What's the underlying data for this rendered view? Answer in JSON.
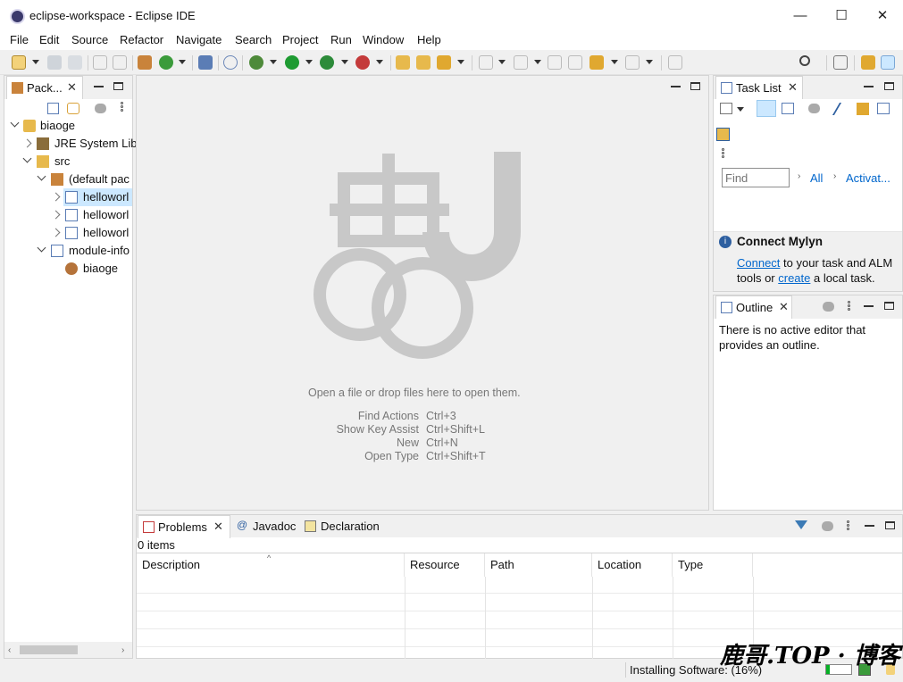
{
  "window": {
    "title": "eclipse-workspace - Eclipse IDE",
    "minimize": "—",
    "maximize": "☐",
    "close": "✕"
  },
  "menu": [
    "File",
    "Edit",
    "Source",
    "Refactor",
    "Navigate",
    "Search",
    "Project",
    "Run",
    "Window",
    "Help"
  ],
  "package_explorer": {
    "tab_label": "Pack...",
    "tree": [
      {
        "label": "biaoge",
        "depth": 0,
        "expanded": true,
        "icon": "project-icon"
      },
      {
        "label": "JRE System Lib",
        "depth": 1,
        "expanded": false,
        "icon": "library-icon"
      },
      {
        "label": "src",
        "depth": 1,
        "expanded": true,
        "icon": "source-folder-icon"
      },
      {
        "label": "(default pac",
        "depth": 2,
        "expanded": true,
        "icon": "package-icon"
      },
      {
        "label": "helloworl",
        "depth": 3,
        "expanded": false,
        "icon": "java-file-icon",
        "selected": true
      },
      {
        "label": "helloworl",
        "depth": 3,
        "expanded": false,
        "icon": "java-file-icon"
      },
      {
        "label": "helloworl",
        "depth": 3,
        "expanded": false,
        "icon": "java-file-icon"
      },
      {
        "label": "module-info",
        "depth": 2,
        "expanded": true,
        "icon": "java-file-icon"
      },
      {
        "label": "biaoge",
        "depth": 3,
        "expanded": null,
        "icon": "module-icon"
      }
    ]
  },
  "editor": {
    "empty_message": "Open a file or drop files here to open them.",
    "shortcuts": [
      {
        "action": "Find Actions",
        "keys": "Ctrl+3"
      },
      {
        "action": "Show Key Assist",
        "keys": "Ctrl+Shift+L"
      },
      {
        "action": "New",
        "keys": "Ctrl+N"
      },
      {
        "action": "Open Type",
        "keys": "Ctrl+Shift+T"
      }
    ]
  },
  "task_list": {
    "tab_label": "Task List",
    "find_placeholder": "Find",
    "all_label": "All",
    "activate_label": "Activat...",
    "mylyn_title": "Connect Mylyn",
    "mylyn_link1": "Connect",
    "mylyn_text1": " to your task and ALM",
    "mylyn_text2": "tools or ",
    "mylyn_link2": "create",
    "mylyn_text3": " a local task."
  },
  "outline": {
    "tab_label": "Outline",
    "message_line1": "There is no active editor that",
    "message_line2": "provides an outline."
  },
  "bottom": {
    "tabs": [
      {
        "label": "Problems",
        "icon": "problems-icon",
        "active": true
      },
      {
        "label": "Javadoc",
        "icon": "javadoc-icon",
        "active": false
      },
      {
        "label": "Declaration",
        "icon": "declaration-icon",
        "active": false
      }
    ],
    "items_count": "0 items",
    "columns": [
      "Description",
      "Resource",
      "Path",
      "Location",
      "Type"
    ]
  },
  "status": {
    "text": "Installing Software: (16%)",
    "progress": 0.16
  },
  "watermark": "鹿哥.TOP · 博客",
  "colors": {
    "accent": "#0066cc",
    "selection": "#cce8ff",
    "watermark": "#000000"
  }
}
